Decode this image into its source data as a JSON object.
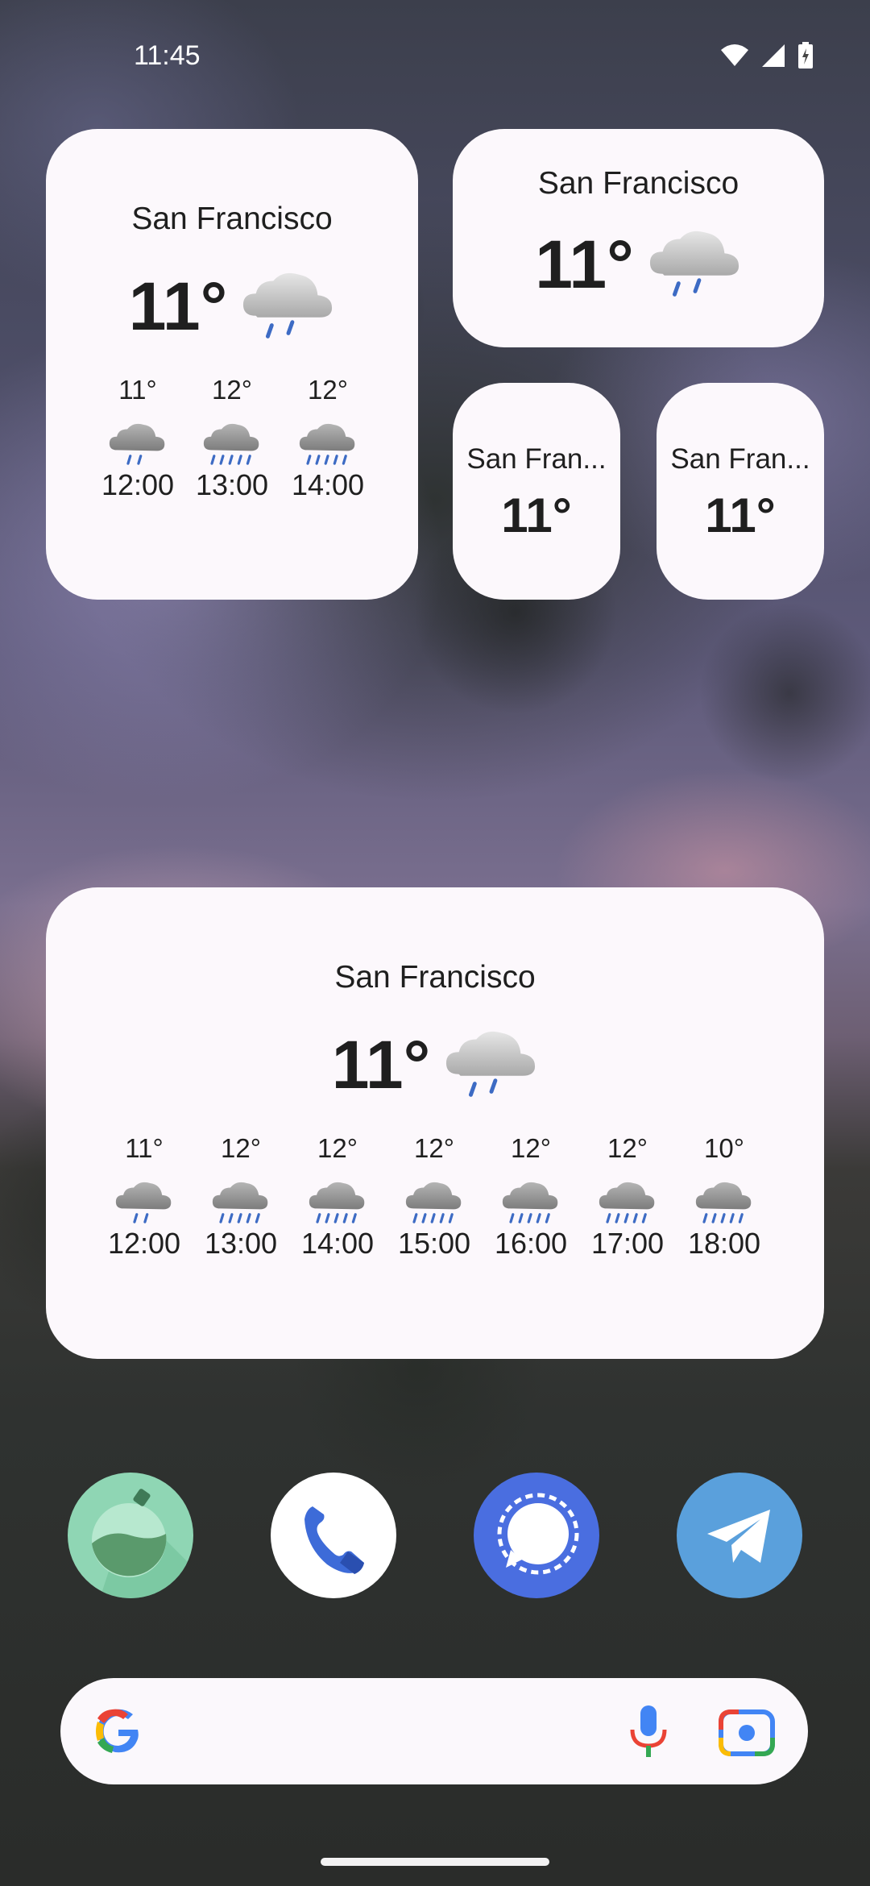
{
  "status_bar": {
    "time": "11:45",
    "icons": [
      "wifi-icon",
      "cellular-signal-icon",
      "battery-charging-icon"
    ]
  },
  "widget_large": {
    "city": "San Francisco",
    "temp": "11°",
    "condition_icon": "rain-cloud-icon",
    "forecast": [
      {
        "temp": "11°",
        "time": "12:00",
        "icon": "light-rain-icon"
      },
      {
        "temp": "12°",
        "time": "13:00",
        "icon": "rain-icon"
      },
      {
        "temp": "12°",
        "time": "14:00",
        "icon": "rain-icon"
      }
    ]
  },
  "widget_medium": {
    "city": "San Francisco",
    "temp": "11°",
    "condition_icon": "rain-cloud-icon"
  },
  "widget_small_1": {
    "city": "San Fran...",
    "temp": "11°"
  },
  "widget_small_2": {
    "city": "San Fran...",
    "temp": "11°"
  },
  "widget_wide": {
    "city": "San Francisco",
    "temp": "11°",
    "condition_icon": "rain-cloud-icon",
    "forecast": [
      {
        "temp": "11°",
        "time": "12:00",
        "icon": "light-rain-icon"
      },
      {
        "temp": "12°",
        "time": "13:00",
        "icon": "rain-icon"
      },
      {
        "temp": "12°",
        "time": "14:00",
        "icon": "rain-icon"
      },
      {
        "temp": "12°",
        "time": "15:00",
        "icon": "rain-icon"
      },
      {
        "temp": "12°",
        "time": "16:00",
        "icon": "rain-icon"
      },
      {
        "temp": "12°",
        "time": "17:00",
        "icon": "rain-icon"
      },
      {
        "temp": "10°",
        "time": "18:00",
        "icon": "rain-icon"
      }
    ]
  },
  "dock": [
    {
      "icon": "potion-flask-app-icon",
      "color": "#8fd6b4"
    },
    {
      "icon": "phone-app-icon",
      "color": "#ffffff"
    },
    {
      "icon": "signal-app-icon",
      "color": "#4a6ee0"
    },
    {
      "icon": "telegram-app-icon",
      "color": "#5aa0dc"
    }
  ],
  "search_bar": {
    "icons": [
      "google-logo-icon",
      "microphone-icon",
      "google-lens-icon"
    ]
  },
  "colors": {
    "widget_bg": "#fcf8fc",
    "text": "#1f1f1f",
    "rain_drop": "#3d6bc4",
    "cloud": "#b8b8b8"
  }
}
